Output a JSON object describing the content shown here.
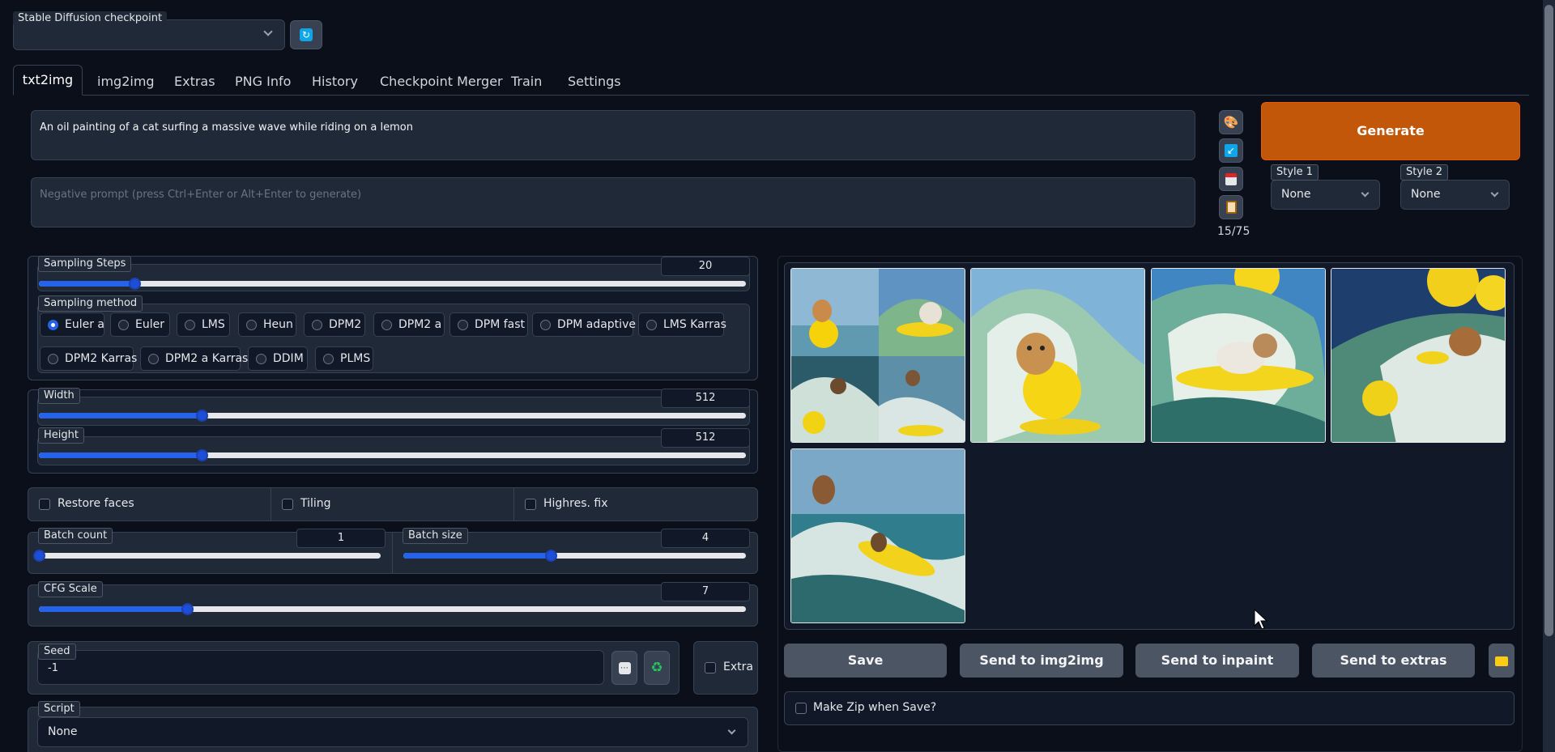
{
  "header": {
    "checkpoint_label": "Stable Diffusion checkpoint",
    "checkpoint_value": ""
  },
  "tabs": [
    "txt2img",
    "img2img",
    "Extras",
    "PNG Info",
    "History",
    "Checkpoint Merger",
    "Train",
    "Settings"
  ],
  "prompt": {
    "value": "An oil painting of a cat surfing a massive wave while riding on a lemon",
    "negative_placeholder": "Negative prompt (press Ctrl+Enter or Alt+Enter to generate)",
    "token_count": "15/75"
  },
  "generate": {
    "label": "Generate",
    "style1_label": "Style 1",
    "style1_value": "None",
    "style2_label": "Style 2",
    "style2_value": "None"
  },
  "params": {
    "sampling_steps_label": "Sampling Steps",
    "sampling_steps": "20",
    "sampling_method_label": "Sampling method",
    "methods": [
      "Euler a",
      "Euler",
      "LMS",
      "Heun",
      "DPM2",
      "DPM2 a",
      "DPM fast",
      "DPM adaptive",
      "LMS Karras",
      "DPM2 Karras",
      "DPM2 a Karras",
      "DDIM",
      "PLMS"
    ],
    "selected_method": "Euler a",
    "width_label": "Width",
    "width": "512",
    "height_label": "Height",
    "height": "512",
    "restore_faces": "Restore faces",
    "tiling": "Tiling",
    "highres": "Highres. fix",
    "batch_count_label": "Batch count",
    "batch_count": "1",
    "batch_size_label": "Batch size",
    "batch_size": "4",
    "cfg_label": "CFG Scale",
    "cfg": "7",
    "seed_label": "Seed",
    "seed": "-1",
    "extra_label": "Extra",
    "script_label": "Script",
    "script_value": "None"
  },
  "slider_levels": {
    "sampling_steps": 0.135,
    "width": 0.23,
    "height": 0.23,
    "batch_count": 0.0,
    "batch_size": 0.43,
    "cfg": 0.21
  },
  "output": {
    "buttons": [
      "Save",
      "Send to img2img",
      "Send to inpaint",
      "Send to extras"
    ],
    "make_zip": "Make Zip when Save?"
  },
  "colors": {
    "accent": "#2563eb",
    "generate": "#c2570a",
    "background": "#0b0f19"
  }
}
